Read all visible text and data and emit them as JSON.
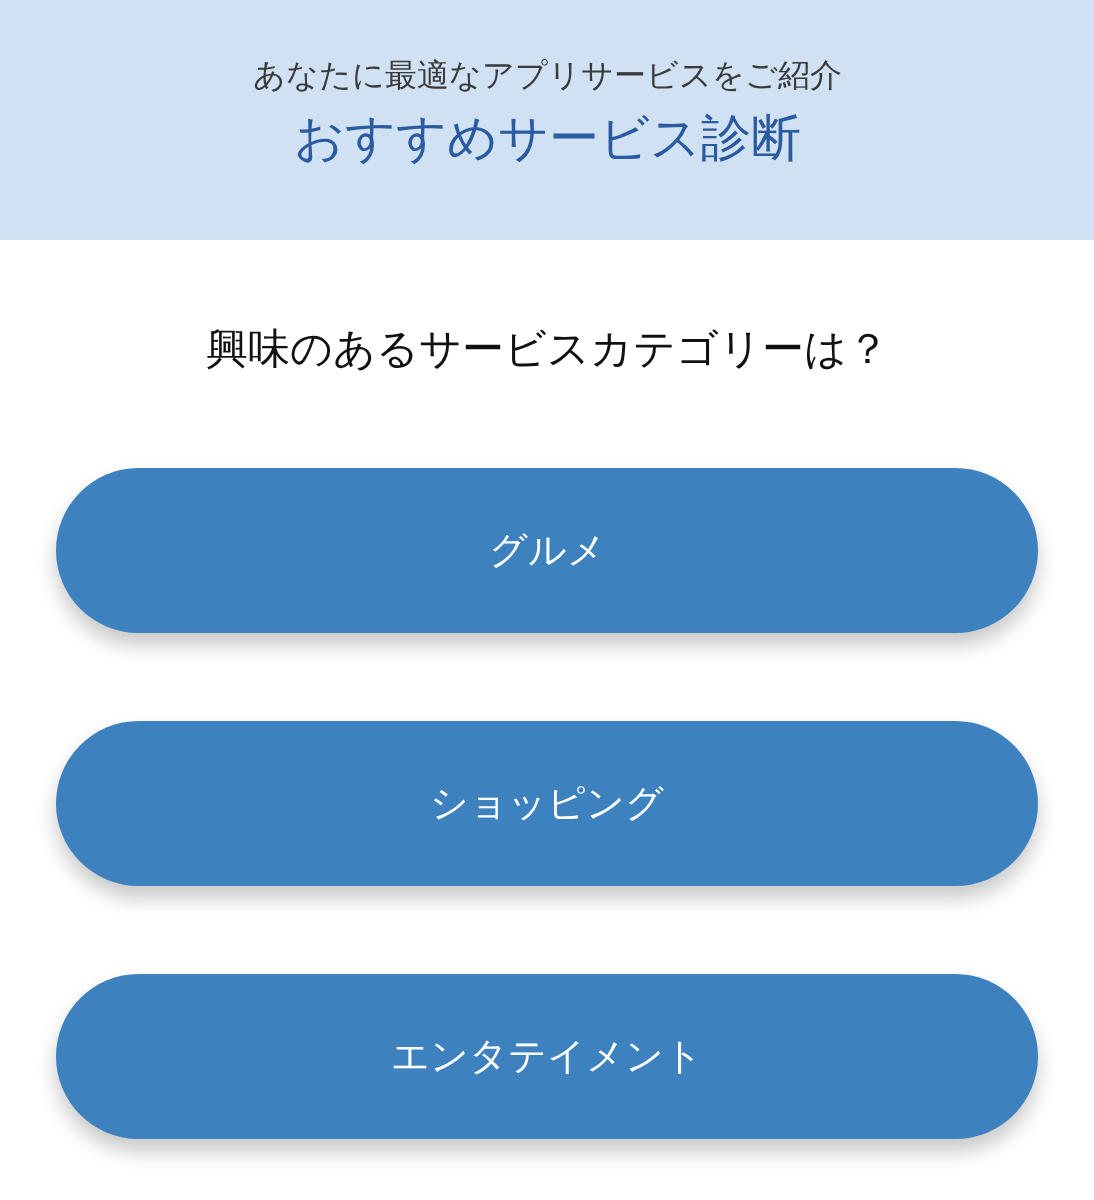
{
  "header": {
    "subtitle": "あなたに最適なアプリサービスをご紹介",
    "title": "おすすめサービス診断"
  },
  "question": "興味のあるサービスカテゴリーは？",
  "options": [
    "グルメ",
    "ショッピング",
    "エンタテイメント"
  ]
}
